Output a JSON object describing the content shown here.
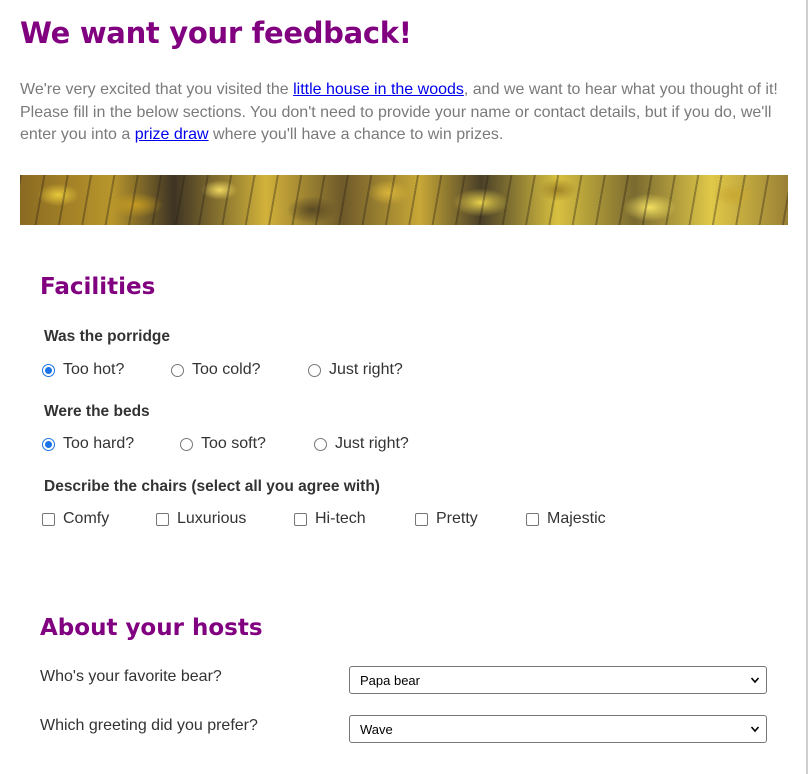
{
  "title": "We want your feedback!",
  "intro": {
    "text1": "We're very excited that you visited the ",
    "link1": "little house in the woods",
    "text2": ", and we want to hear what you thought of it! Please fill in the below sections. You don't need to provide your name or contact details, but if you do, we'll enter you into a ",
    "link2": "prize draw",
    "text3": " where you'll have a chance to win prizes."
  },
  "facilities": {
    "heading": "Facilities",
    "porridge": {
      "question": "Was the porridge",
      "options": [
        "Too hot?",
        "Too cold?",
        "Just right?"
      ],
      "selected_index": 0
    },
    "beds": {
      "question": "Were the beds",
      "options": [
        "Too hard?",
        "Too soft?",
        "Just right?"
      ],
      "selected_index": 0
    },
    "chairs": {
      "question": "Describe the chairs (select all you agree with)",
      "options": [
        "Comfy",
        "Luxurious",
        "Hi-tech",
        "Pretty",
        "Majestic"
      ],
      "checked": [
        false,
        false,
        false,
        false,
        false
      ]
    }
  },
  "hosts": {
    "heading": "About your hosts",
    "bear": {
      "label": "Who's your favorite bear?",
      "value": "Papa bear"
    },
    "greeting": {
      "label": "Which greeting did you prefer?",
      "value": "Wave"
    }
  },
  "colors": {
    "heading": "#800080",
    "link": "#0000ee",
    "radio_checked": "#1a73e8"
  }
}
